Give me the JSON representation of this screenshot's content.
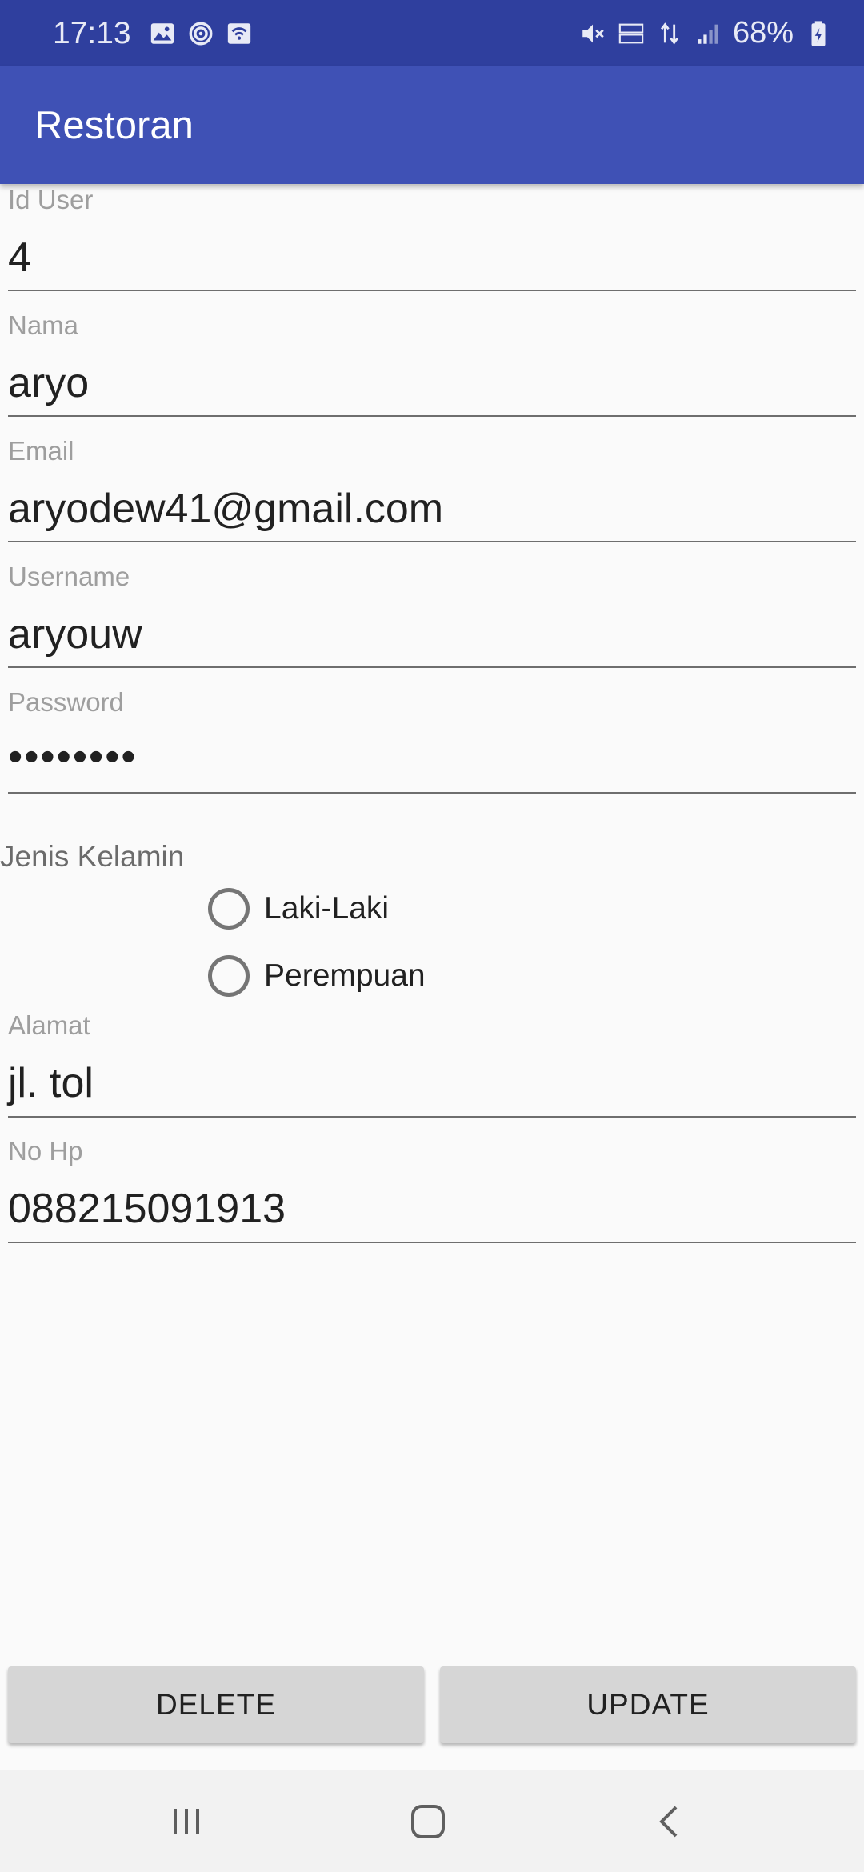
{
  "status_bar": {
    "time": "17:13",
    "battery": "68%",
    "left_icons": [
      "image-icon",
      "sync-icon",
      "wifi-icon"
    ],
    "right_icons": [
      "mute-icon",
      "volte-icon",
      "4g-icon",
      "signal-icon",
      "battery-icon"
    ]
  },
  "app_bar": {
    "title": "Restoran"
  },
  "form": {
    "id_user": {
      "label": "Id User",
      "value": "4"
    },
    "nama": {
      "label": "Nama",
      "value": "aryo"
    },
    "email": {
      "label": "Email",
      "value": "aryodew41@gmail.com"
    },
    "username": {
      "label": "Username",
      "value": "aryouw"
    },
    "password": {
      "label": "Password",
      "value": "••••••••"
    },
    "gender": {
      "label": "Jenis Kelamin",
      "options": [
        "Laki-Laki",
        "Perempuan"
      ]
    },
    "alamat": {
      "label": "Alamat",
      "value": "jl. tol"
    },
    "no_hp": {
      "label": "No Hp",
      "value": "088215091913"
    }
  },
  "buttons": {
    "delete": "DELETE",
    "update": "UPDATE"
  },
  "nav_bar": {
    "icons": [
      "recents-icon",
      "home-icon",
      "back-icon"
    ]
  },
  "colors": {
    "status_bar": "#2f3f9e",
    "app_bar": "#3f51b5",
    "background": "#fafafa",
    "button": "#d6d6d6"
  }
}
